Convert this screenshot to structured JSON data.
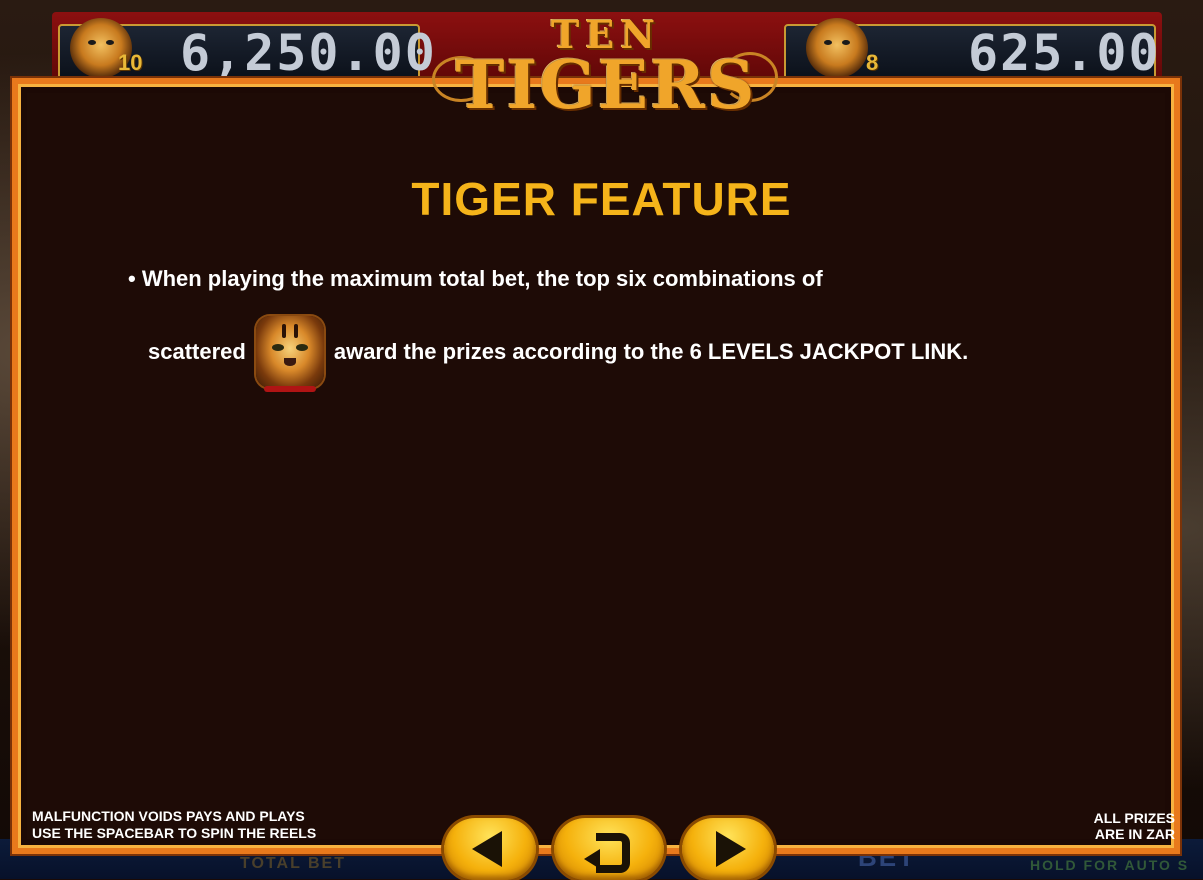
{
  "jackpot": {
    "left_value": "6,250.00",
    "left_level": "10",
    "right_value": "625.00",
    "right_level": "8"
  },
  "logo": {
    "line1": "TEN",
    "line2": "TIGERS"
  },
  "help": {
    "title": "TIGER FEATURE",
    "line1": "• When playing the maximum total bet, the top six combinations of",
    "line2_before": "scattered",
    "line2_after": "award the prizes according to the 6 LEVELS JACKPOT LINK."
  },
  "footer": {
    "left_line1": "MALFUNCTION VOIDS PAYS AND PLAYS",
    "left_line2": "USE THE SPACEBAR TO SPIN THE REELS",
    "right_line1": "ALL PRIZES",
    "right_line2": "ARE IN ZAR"
  },
  "background_controls": {
    "total_bet": "TOTAL BET",
    "bet": "BET",
    "hold": "HOLD FOR AUTO S"
  },
  "icons": {
    "prev": "triangle-left-icon",
    "back": "return-arrow-icon",
    "next": "triangle-right-icon",
    "symbol": "tiger-head-icon"
  },
  "colors": {
    "title": "#f5b41a",
    "frame": "#e8791c",
    "button": "#f5b10c"
  }
}
